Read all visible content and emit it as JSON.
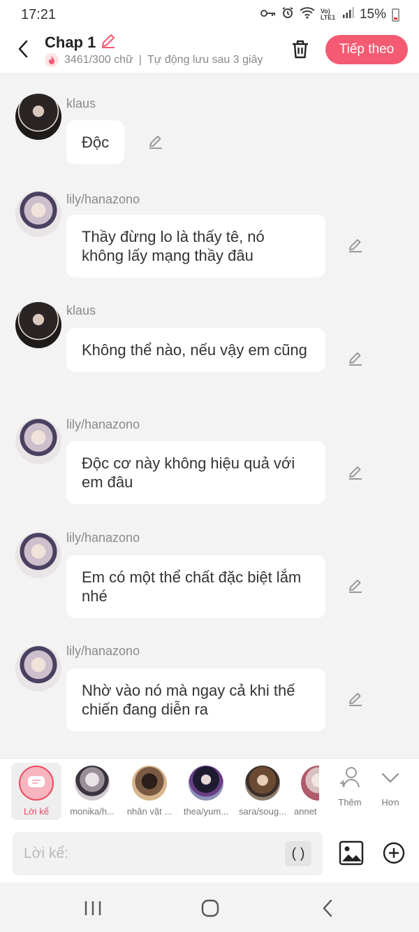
{
  "status_bar": {
    "time": "17:21",
    "battery": "15%",
    "network": "Vo) LTE1"
  },
  "header": {
    "title": "Chap 1",
    "word_count": "3461/300 chữ",
    "separator": "|",
    "autosave": "Tự động lưu sau 3 giây",
    "next_label": "Tiếp theo"
  },
  "messages": [
    {
      "name": "klaus",
      "text": "Độc"
    },
    {
      "name": "lily/hanazono",
      "text": "Thầy đừng lo là thấy tê, nó không lấy mạng thầy đâu"
    },
    {
      "name": "klaus",
      "text": "Không thể nào, nếu vậy em cũng"
    },
    {
      "name": "lily/hanazono",
      "text": "Độc cơ này không hiệu quả với em đâu"
    },
    {
      "name": "lily/hanazono",
      "text": "Em có một thể chất đặc biệt lắm nhé"
    },
    {
      "name": "lily/hanazono",
      "text": "Nhờ vào nó mà ngay cả khi thế chiến đang diễn ra"
    }
  ],
  "characters": {
    "narrator_label": "Lời kể",
    "items": [
      {
        "label": "monika/h..."
      },
      {
        "label": "nhân vật ..."
      },
      {
        "label": "thea/yum..."
      },
      {
        "label": "sara/soug..."
      },
      {
        "label": "annet"
      }
    ],
    "add_label": "Thêm",
    "more_label": "Hơn"
  },
  "input": {
    "placeholder": "Lời kể:",
    "paren_label": "( )"
  },
  "colors": {
    "accent": "#f45b73",
    "background": "#f3f3f3",
    "bubble": "#ffffff"
  }
}
